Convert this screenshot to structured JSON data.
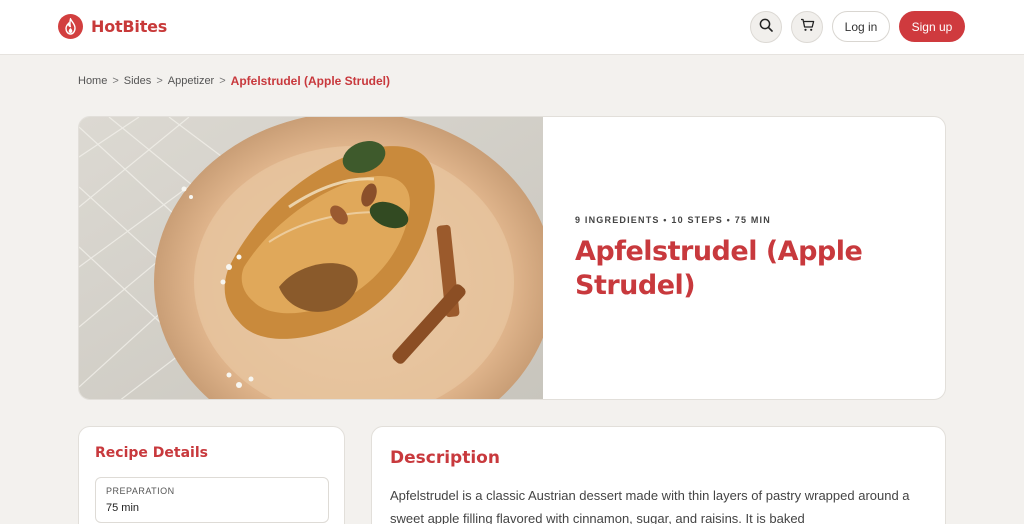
{
  "header": {
    "brand": "HotBites",
    "login_label": "Log in",
    "signup_label": "Sign up"
  },
  "breadcrumb": {
    "items": [
      "Home",
      "Sides",
      "Appetizer"
    ],
    "separator": ">",
    "current": "Apfelstrudel (Apple Strudel)"
  },
  "recipe": {
    "meta": "9 INGREDIENTS • 10 STEPS • 75 MIN",
    "title": "Apfelstrudel (Apple Strudel)"
  },
  "details": {
    "heading": "Recipe Details",
    "prep_label": "PREPARATION",
    "prep_value": "75 min"
  },
  "description": {
    "heading": "Description",
    "text": "Apfelstrudel is a classic Austrian dessert made with thin layers of pastry wrapped around a sweet apple filling flavored with cinnamon, sugar, and raisins. It is baked"
  },
  "colors": {
    "accent": "#c8393d",
    "background": "#f3f1ee"
  },
  "icons": {
    "logo": "flame-icon",
    "search": "search-icon",
    "cart": "cart-icon"
  }
}
